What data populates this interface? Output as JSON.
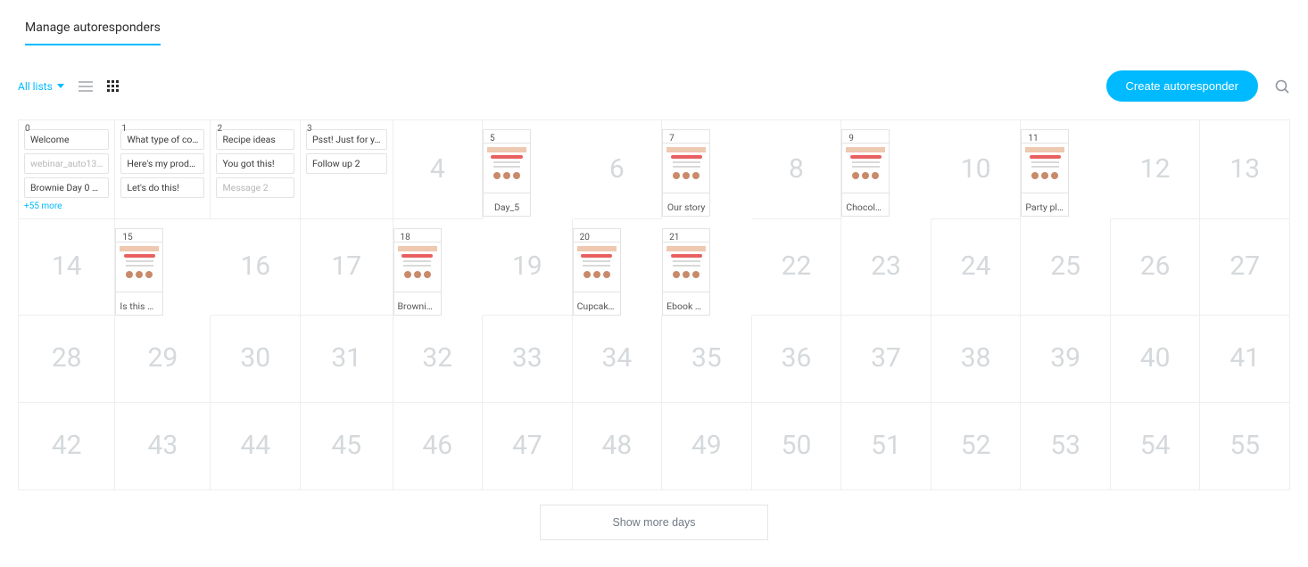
{
  "header": {
    "title": "Manage autoresponders"
  },
  "toolbar": {
    "filter_label": "All lists",
    "create_label": "Create autoresponder"
  },
  "footer": {
    "show_more_label": "Show more days"
  },
  "cells": [
    {
      "day": 0,
      "kind": "pills",
      "pills": [
        {
          "label": "Welcome",
          "muted": false
        },
        {
          "label": "webinar_auto13…",
          "muted": true
        },
        {
          "label": "Brownie Day 0 …",
          "muted": false
        }
      ],
      "more_label": "+55 more"
    },
    {
      "day": 1,
      "kind": "pills",
      "pills": [
        {
          "label": "What type of co…",
          "muted": false
        },
        {
          "label": "Here's my prod…",
          "muted": false
        },
        {
          "label": "Let's do this!",
          "muted": false
        }
      ]
    },
    {
      "day": 2,
      "kind": "pills",
      "pills": [
        {
          "label": "Recipe ideas",
          "muted": false
        },
        {
          "label": "You got this!",
          "muted": false
        },
        {
          "label": "Message 2",
          "muted": true
        }
      ]
    },
    {
      "day": 3,
      "kind": "pills",
      "pills": [
        {
          "label": "Psst! Just for y…",
          "muted": false
        },
        {
          "label": "Follow up 2",
          "muted": false
        }
      ]
    },
    {
      "day": 4,
      "kind": "empty"
    },
    {
      "day": 5,
      "kind": "thumb",
      "thumb_label": "Day_5"
    },
    {
      "day": 6,
      "kind": "empty"
    },
    {
      "day": 7,
      "kind": "thumb",
      "thumb_label": "Our story"
    },
    {
      "day": 8,
      "kind": "empty"
    },
    {
      "day": 9,
      "kind": "thumb",
      "thumb_label": "Chocolate Monste…"
    },
    {
      "day": 10,
      "kind": "empty"
    },
    {
      "day": 11,
      "kind": "thumb",
      "thumb_label": "Party planning?"
    },
    {
      "day": 12,
      "kind": "empty"
    },
    {
      "day": 13,
      "kind": "empty"
    },
    {
      "day": 14,
      "kind": "empty"
    },
    {
      "day": 15,
      "kind": "thumb",
      "thumb_label": "Is this what you're…"
    },
    {
      "day": 16,
      "kind": "empty"
    },
    {
      "day": 17,
      "kind": "empty"
    },
    {
      "day": 18,
      "kind": "thumb",
      "thumb_label": "Brownie offer"
    },
    {
      "day": 19,
      "kind": "empty"
    },
    {
      "day": 20,
      "kind": "thumb",
      "thumb_label": "Cupcake offer"
    },
    {
      "day": 21,
      "kind": "thumb",
      "thumb_label": "Ebook purchase"
    },
    {
      "day": 22,
      "kind": "empty"
    },
    {
      "day": 23,
      "kind": "empty"
    },
    {
      "day": 24,
      "kind": "empty"
    },
    {
      "day": 25,
      "kind": "empty"
    },
    {
      "day": 26,
      "kind": "empty"
    },
    {
      "day": 27,
      "kind": "empty"
    },
    {
      "day": 28,
      "kind": "empty"
    },
    {
      "day": 29,
      "kind": "empty"
    },
    {
      "day": 30,
      "kind": "empty"
    },
    {
      "day": 31,
      "kind": "empty"
    },
    {
      "day": 32,
      "kind": "empty"
    },
    {
      "day": 33,
      "kind": "empty"
    },
    {
      "day": 34,
      "kind": "empty"
    },
    {
      "day": 35,
      "kind": "empty"
    },
    {
      "day": 36,
      "kind": "empty"
    },
    {
      "day": 37,
      "kind": "empty"
    },
    {
      "day": 38,
      "kind": "empty"
    },
    {
      "day": 39,
      "kind": "empty"
    },
    {
      "day": 40,
      "kind": "empty"
    },
    {
      "day": 41,
      "kind": "empty"
    },
    {
      "day": 42,
      "kind": "empty"
    },
    {
      "day": 43,
      "kind": "empty"
    },
    {
      "day": 44,
      "kind": "empty"
    },
    {
      "day": 45,
      "kind": "empty"
    },
    {
      "day": 46,
      "kind": "empty"
    },
    {
      "day": 47,
      "kind": "empty"
    },
    {
      "day": 48,
      "kind": "empty"
    },
    {
      "day": 49,
      "kind": "empty"
    },
    {
      "day": 50,
      "kind": "empty"
    },
    {
      "day": 51,
      "kind": "empty"
    },
    {
      "day": 52,
      "kind": "empty"
    },
    {
      "day": 53,
      "kind": "empty"
    },
    {
      "day": 54,
      "kind": "empty"
    },
    {
      "day": 55,
      "kind": "empty"
    }
  ]
}
